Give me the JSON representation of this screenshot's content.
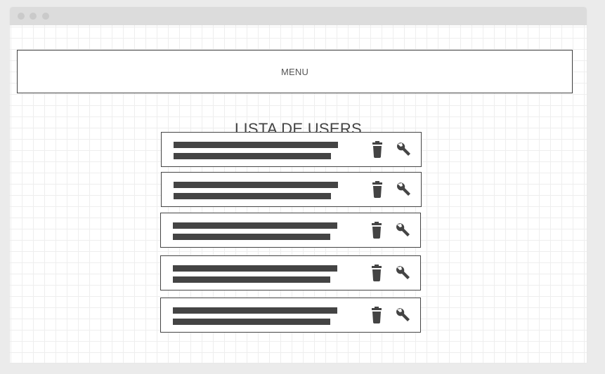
{
  "menu": {
    "label": "MENU"
  },
  "page": {
    "title": "LISTA DE USERS"
  },
  "colors": {
    "ink": "#444444",
    "background": "#ebebeb",
    "grid": "#eeeeee"
  },
  "users": [
    {
      "delete_icon": "trash-icon",
      "edit_icon": "wrench-icon"
    },
    {
      "delete_icon": "trash-icon",
      "edit_icon": "wrench-icon"
    },
    {
      "delete_icon": "trash-icon",
      "edit_icon": "wrench-icon"
    },
    {
      "delete_icon": "trash-icon",
      "edit_icon": "wrench-icon"
    },
    {
      "delete_icon": "trash-icon",
      "edit_icon": "wrench-icon"
    }
  ]
}
